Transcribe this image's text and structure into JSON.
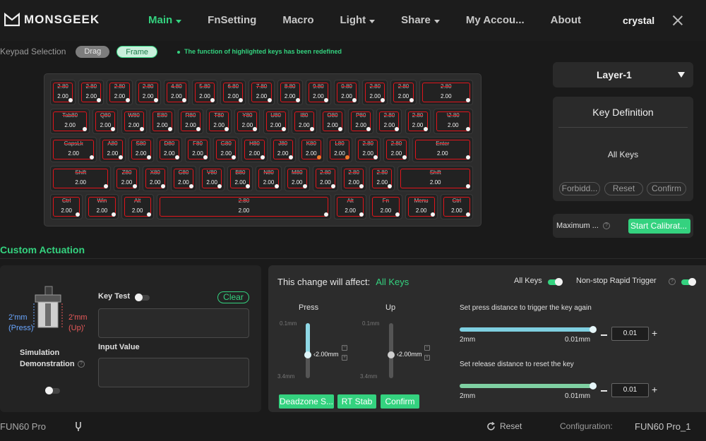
{
  "brand": "MONSGEEK",
  "nav": [
    {
      "label": "Main",
      "dropdown": true,
      "active": true
    },
    {
      "label": "FnSetting",
      "dropdown": false,
      "active": false
    },
    {
      "label": "Macro",
      "dropdown": false,
      "active": false
    },
    {
      "label": "Light",
      "dropdown": true,
      "active": false
    },
    {
      "label": "Share",
      "dropdown": true,
      "active": false
    },
    {
      "label": "My Accou...",
      "dropdown": false,
      "active": false
    },
    {
      "label": "About",
      "dropdown": false,
      "active": false
    }
  ],
  "user": "crystal",
  "selection": {
    "label": "Keypad Selection",
    "drag": "Drag",
    "frame": "Frame",
    "hint": "The function of highlighted keys has been redefined"
  },
  "keyboard": {
    "rows": [
      [
        {
          "l": "2.80",
          "v": "2.00",
          "w": 1
        },
        {
          "l": "2.80",
          "v": "2.00",
          "w": 1
        },
        {
          "l": "2.80",
          "v": "2.00",
          "w": 1
        },
        {
          "l": "2.80",
          "v": "2.00",
          "w": 1
        },
        {
          "l": "4.80",
          "v": "2.00",
          "w": 1
        },
        {
          "l": "5.80",
          "v": "2.00",
          "w": 1
        },
        {
          "l": "6.80",
          "v": "2.00",
          "w": 1
        },
        {
          "l": "7.80",
          "v": "2.00",
          "w": 1
        },
        {
          "l": "8.80",
          "v": "2.00",
          "w": 1
        },
        {
          "l": "9.80",
          "v": "2.00",
          "w": 1
        },
        {
          "l": "0.80",
          "v": "2.00",
          "w": 1
        },
        {
          "l": "2.80",
          "v": "2.00",
          "w": 1
        },
        {
          "l": "2.80",
          "v": "2.00",
          "w": 1
        },
        {
          "l": "2.80",
          "v": "2.00",
          "w": 2
        }
      ],
      [
        {
          "l": "Tab80",
          "v": "2.00",
          "w": 1.5
        },
        {
          "l": "Q80",
          "v": "2.00",
          "w": 1
        },
        {
          "l": "W80",
          "v": "2.00",
          "w": 1
        },
        {
          "l": "E80",
          "v": "2.00",
          "w": 1
        },
        {
          "l": "R80",
          "v": "2.00",
          "w": 1
        },
        {
          "l": "T80",
          "v": "2.00",
          "w": 1
        },
        {
          "l": "Y80",
          "v": "2.00",
          "w": 1
        },
        {
          "l": "U80",
          "v": "2.00",
          "w": 1
        },
        {
          "l": "I80",
          "v": "2.00",
          "w": 1
        },
        {
          "l": "O80",
          "v": "2.00",
          "w": 1
        },
        {
          "l": "P80",
          "v": "2.00",
          "w": 1
        },
        {
          "l": "2.80",
          "v": "2.00",
          "w": 1
        },
        {
          "l": "2.80",
          "v": "2.00",
          "w": 1
        },
        {
          "l": "\\2.80",
          "v": "2.00",
          "w": 1.5
        }
      ],
      [
        {
          "l": "CapsLk",
          "v": "2.00",
          "w": 1.75
        },
        {
          "l": "A80",
          "v": "2.00",
          "w": 1
        },
        {
          "l": "S80",
          "v": "2.00",
          "w": 1
        },
        {
          "l": "D80",
          "v": "2.00",
          "w": 1
        },
        {
          "l": "F80",
          "v": "2.00",
          "w": 1
        },
        {
          "l": "G80",
          "v": "2.00",
          "w": 1
        },
        {
          "l": "H80",
          "v": "2.00",
          "w": 1
        },
        {
          "l": "J80",
          "v": "2.00",
          "w": 1
        },
        {
          "l": "K80",
          "v": "2.00",
          "w": 1,
          "o": true
        },
        {
          "l": "L80",
          "v": "2.00",
          "w": 1,
          "o": true
        },
        {
          "l": "2.80",
          "v": "2.00",
          "w": 1
        },
        {
          "l": "2.80",
          "v": "2.00",
          "w": 1
        },
        {
          "l": "Enter",
          "v": "2.00",
          "w": 2.25
        }
      ],
      [
        {
          "l": "Shift",
          "v": "2.00",
          "w": 2.25
        },
        {
          "l": "Z80",
          "v": "2.00",
          "w": 1
        },
        {
          "l": "X80",
          "v": "2.00",
          "w": 1
        },
        {
          "l": "C80",
          "v": "2.00",
          "w": 1
        },
        {
          "l": "V80",
          "v": "2.00",
          "w": 1
        },
        {
          "l": "B80",
          "v": "2.00",
          "w": 1
        },
        {
          "l": "N80",
          "v": "2.00",
          "w": 1
        },
        {
          "l": "M80",
          "v": "2.00",
          "w": 1
        },
        {
          "l": "2.80",
          "v": "2.00",
          "w": 1
        },
        {
          "l": "2.80",
          "v": "2.00",
          "w": 1
        },
        {
          "l": "2.80",
          "v": "2.00",
          "w": 1
        },
        {
          "l": "Shift",
          "v": "2.00",
          "w": 2.75
        }
      ],
      [
        {
          "l": "Ctrl",
          "v": "2.00",
          "w": 1.25
        },
        {
          "l": "Win",
          "v": "2.00",
          "w": 1.25
        },
        {
          "l": "Alt",
          "v": "2.00",
          "w": 1.25
        },
        {
          "l": "2.80",
          "v": "2.00",
          "w": 6.25
        },
        {
          "l": "Alt",
          "v": "2.00",
          "w": 1.25
        },
        {
          "l": "Fn",
          "v": "2.00",
          "w": 1.25
        },
        {
          "l": "Menu",
          "v": "2.00",
          "w": 1.25
        },
        {
          "l": "Ctrl",
          "v": "2.00",
          "w": 1.25
        }
      ]
    ]
  },
  "layer": "Layer-1",
  "key_definition": {
    "title": "Key Definition",
    "value": "All Keys",
    "buttons": [
      "Forbidd...",
      "Reset",
      "Confirm"
    ]
  },
  "maximum": {
    "label": "Maximum ...",
    "button": "Start Calibrat..."
  },
  "custom_actuation": {
    "title": "Custom Actuation",
    "switch": {
      "left": "2mm\n(Press)",
      "right": "2mm\n(Up)"
    },
    "simulation": "Simulation Demonstration",
    "key_test": "Key Test",
    "clear": "Clear",
    "input_value": "Input Value",
    "affect_label": "This change will affect:",
    "affect_value": "All Keys",
    "all_keys_toggle": "All Keys",
    "rapid_trigger": "Non-stop Rapid Trigger",
    "press": {
      "label": "Press",
      "top": "0.1mm",
      "bottom": "3.4mm",
      "value": "2.00mm"
    },
    "up": {
      "label": "Up",
      "top": "0.1mm",
      "bottom": "3.4mm",
      "value": "2.00mm"
    },
    "buttons": [
      "Deadzone S...",
      "RT Stab",
      "Confirm"
    ],
    "press_again": {
      "title": "Set press distance to trigger the key again",
      "min": "2mm",
      "max": "0.01mm",
      "value": "0.01"
    },
    "release_reset": {
      "title": "Set release distance to reset the key",
      "min": "2mm",
      "max": "0.01mm",
      "value": "0.01"
    }
  },
  "footer": {
    "device": "FUN60 Pro",
    "reset": "Reset",
    "config_label": "Configuration:",
    "config_value": "FUN60  Pro_1"
  },
  "colors": {
    "accent": "#34d27f",
    "key_border": "#e0151c",
    "background": "#1a1a1a"
  }
}
